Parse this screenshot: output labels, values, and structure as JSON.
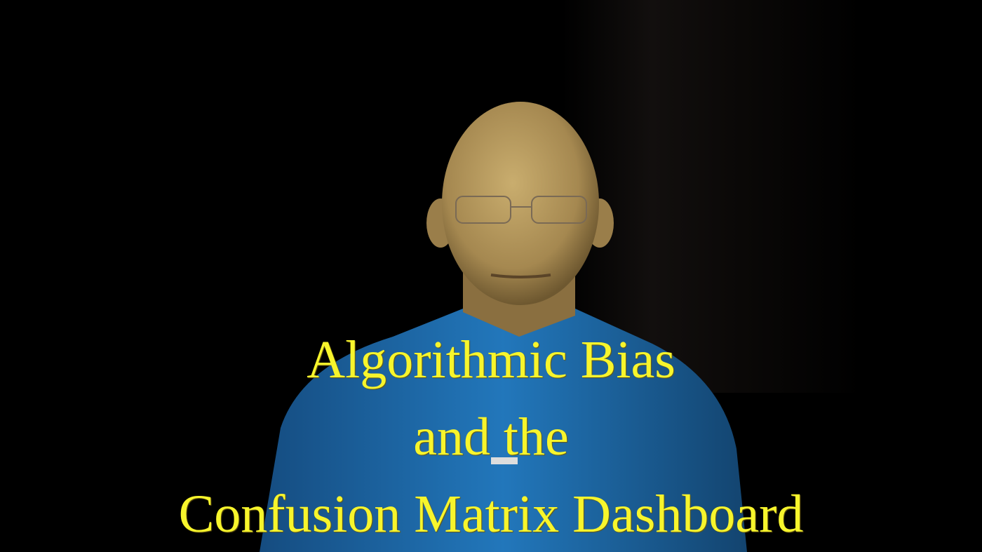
{
  "title": {
    "line1": "Algorithmic Bias",
    "line2": "and the",
    "line3": "Confusion Matrix Dashboard"
  },
  "colors": {
    "title_text": "#f7f52c",
    "background": "#000000",
    "shirt": "#1f6fb0",
    "skin": "#b89a5e"
  }
}
